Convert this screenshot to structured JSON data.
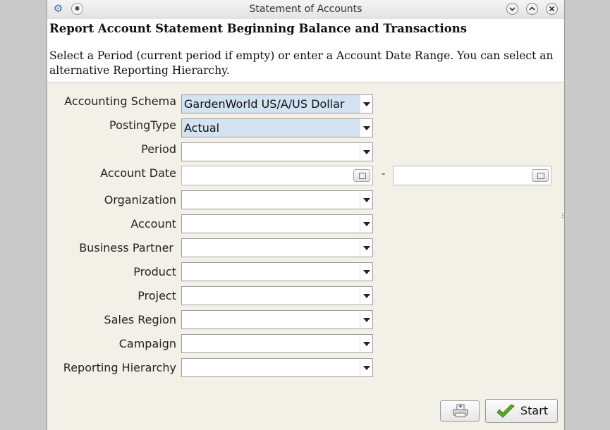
{
  "window": {
    "title": "Statement of Accounts"
  },
  "header": {
    "title": "Report Account Statement Beginning Balance and Transactions",
    "description": "Select a Period (current period if empty) or enter a Account Date Range. You can select an alternative Reporting Hierarchy."
  },
  "form": {
    "accounting_schema": {
      "label": "Accounting Schema",
      "value": "GardenWorld US/A/US Dollar"
    },
    "posting_type": {
      "label": "PostingType",
      "value": "Actual"
    },
    "period": {
      "label": "Period",
      "value": ""
    },
    "account_date": {
      "label": "Account Date",
      "from": "",
      "to": "",
      "separator": "-"
    },
    "organization": {
      "label": "Organization",
      "value": ""
    },
    "account": {
      "label": "Account",
      "value": ""
    },
    "business_partner": {
      "label": "Business Partner",
      "value": ""
    },
    "product": {
      "label": "Product",
      "value": ""
    },
    "project": {
      "label": "Project",
      "value": ""
    },
    "sales_region": {
      "label": "Sales Region",
      "value": ""
    },
    "campaign": {
      "label": "Campaign",
      "value": ""
    },
    "reporting_hierarchy": {
      "label": "Reporting Hierarchy",
      "value": ""
    }
  },
  "buttons": {
    "start": "Start"
  },
  "colors": {
    "selected_field": "#d3e3f2",
    "panel": "#f3f0e8",
    "check": "#5fa82a"
  }
}
